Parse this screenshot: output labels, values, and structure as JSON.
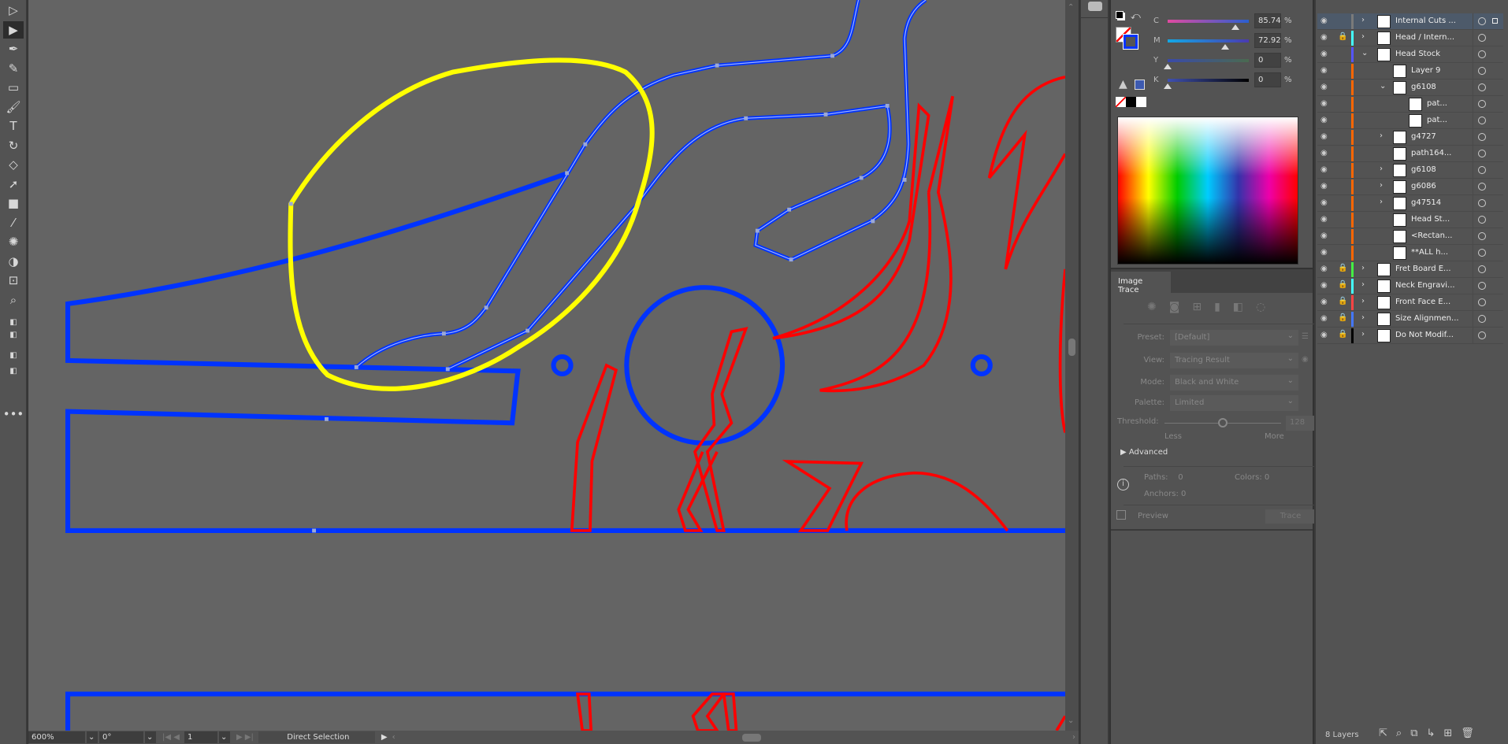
{
  "toolbar": {
    "tools": [
      {
        "name": "selection-tool",
        "glyph": "▷"
      },
      {
        "name": "direct-selection-tool",
        "glyph": "▶"
      },
      {
        "name": "pen-tool",
        "glyph": "✒"
      },
      {
        "name": "curvature-tool",
        "glyph": "✎"
      },
      {
        "name": "rectangle-tool",
        "glyph": "▭"
      },
      {
        "name": "paintbrush-tool",
        "glyph": "🖌"
      },
      {
        "name": "type-tool",
        "glyph": "T"
      },
      {
        "name": "rotate-tool",
        "glyph": "↻"
      },
      {
        "name": "eraser-tool",
        "glyph": "◇"
      },
      {
        "name": "lasso-tool",
        "glyph": "➚"
      },
      {
        "name": "gradient-tool",
        "glyph": "■"
      },
      {
        "name": "eyedropper-tool",
        "glyph": "⁄"
      },
      {
        "name": "puppet-warp-tool",
        "glyph": "✺"
      },
      {
        "name": "shape-builder-tool",
        "glyph": "◑"
      },
      {
        "name": "artboard-tool",
        "glyph": "⊡"
      },
      {
        "name": "zoom-tool",
        "glyph": "⌕"
      }
    ],
    "more": "•••"
  },
  "status": {
    "zoom": "600%",
    "rotation": "0°",
    "artboard": "1",
    "tool": "Direct Selection"
  },
  "color": {
    "sliders": [
      {
        "label": "C",
        "value": "85.74",
        "fraction": 0.8574,
        "gradient": "linear-gradient(90deg,#e04aa0,#2a5fd0)"
      },
      {
        "label": "M",
        "value": "72.92",
        "fraction": 0.7292,
        "gradient": "linear-gradient(90deg,#12a8e6,#4a3ab0)"
      },
      {
        "label": "Y",
        "value": "0",
        "fraction": 0,
        "gradient": "linear-gradient(90deg,#3a4aa8,#4a6a50)"
      },
      {
        "label": "K",
        "value": "0",
        "fraction": 0,
        "gradient": "linear-gradient(90deg,#3f50b0,#000)"
      }
    ],
    "percent": "%",
    "stroke_color": "#0033ff",
    "fill_swatch": "#3d5ab0"
  },
  "image_trace": {
    "tab": "Image Trace",
    "preset": {
      "label": "Preset:",
      "value": "[Default]"
    },
    "view": {
      "label": "View:",
      "value": "Tracing Result"
    },
    "mode": {
      "label": "Mode:",
      "value": "Black and White"
    },
    "palette": {
      "label": "Palette:",
      "value": "Limited"
    },
    "threshold": {
      "label": "Threshold:",
      "value": "128",
      "less": "Less",
      "more": "More",
      "fraction": 0.5
    },
    "advanced": "Advanced",
    "paths": {
      "label": "Paths:",
      "value": "0"
    },
    "colors": {
      "label": "Colors:",
      "value": "0"
    },
    "anchors": {
      "label": "Anchors:",
      "value": "0"
    },
    "preview": "Preview",
    "trace": "Trace"
  },
  "layers": {
    "count": "8 Layers",
    "rows": [
      {
        "name": "Internal Cuts ...",
        "color": "#7a7a7a",
        "level": 0,
        "twirl": "›",
        "lock": false,
        "selected": true
      },
      {
        "name": "Head / Intern...",
        "color": "#4ff",
        "level": 0,
        "twirl": "›",
        "lock": true
      },
      {
        "name": "Head Stock",
        "color": "#5555ff",
        "level": 0,
        "twirl": "⌄",
        "lock": false
      },
      {
        "name": "Layer 9",
        "color": "#ff6600",
        "level": 1,
        "twirl": "",
        "lock": false
      },
      {
        "name": "g6108",
        "color": "#ff6600",
        "level": 1,
        "twirl": "⌄",
        "lock": false
      },
      {
        "name": "pat...",
        "color": "#ff6600",
        "level": 2,
        "twirl": "",
        "lock": false
      },
      {
        "name": "pat...",
        "color": "#ff6600",
        "level": 2,
        "twirl": "",
        "lock": false
      },
      {
        "name": "g4727",
        "color": "#ff6600",
        "level": 1,
        "twirl": "›",
        "lock": false
      },
      {
        "name": "path164...",
        "color": "#ff6600",
        "level": 1,
        "twirl": "",
        "lock": false
      },
      {
        "name": "g6108",
        "color": "#ff6600",
        "level": 1,
        "twirl": "›",
        "lock": false
      },
      {
        "name": "g6086",
        "color": "#ff6600",
        "level": 1,
        "twirl": "›",
        "lock": false
      },
      {
        "name": "g47514",
        "color": "#ff6600",
        "level": 1,
        "twirl": "›",
        "lock": false
      },
      {
        "name": "Head St...",
        "color": "#ff6600",
        "level": 1,
        "twirl": "",
        "lock": false
      },
      {
        "name": "<Rectan...",
        "color": "#ff6600",
        "level": 1,
        "twirl": "",
        "lock": false
      },
      {
        "name": "**ALL h...",
        "color": "#ff6600",
        "level": 1,
        "twirl": "",
        "lock": false
      },
      {
        "name": "Fret Board E...",
        "color": "#44ee44",
        "level": 0,
        "twirl": "›",
        "lock": true
      },
      {
        "name": "Neck Engravi...",
        "color": "#4ff",
        "level": 0,
        "twirl": "›",
        "lock": true
      },
      {
        "name": "Front Face E...",
        "color": "#ff4444",
        "level": 0,
        "twirl": "›",
        "lock": true
      },
      {
        "name": "Size Alignmen...",
        "color": "#4477ff",
        "level": 0,
        "twirl": "›",
        "lock": true
      },
      {
        "name": "Do Not Modif...",
        "color": "#000000",
        "level": 0,
        "twirl": "›",
        "lock": true
      }
    ]
  },
  "artwork": {
    "blue": "#0033ff",
    "red": "#ff0000",
    "yellow": "#ffff00"
  }
}
